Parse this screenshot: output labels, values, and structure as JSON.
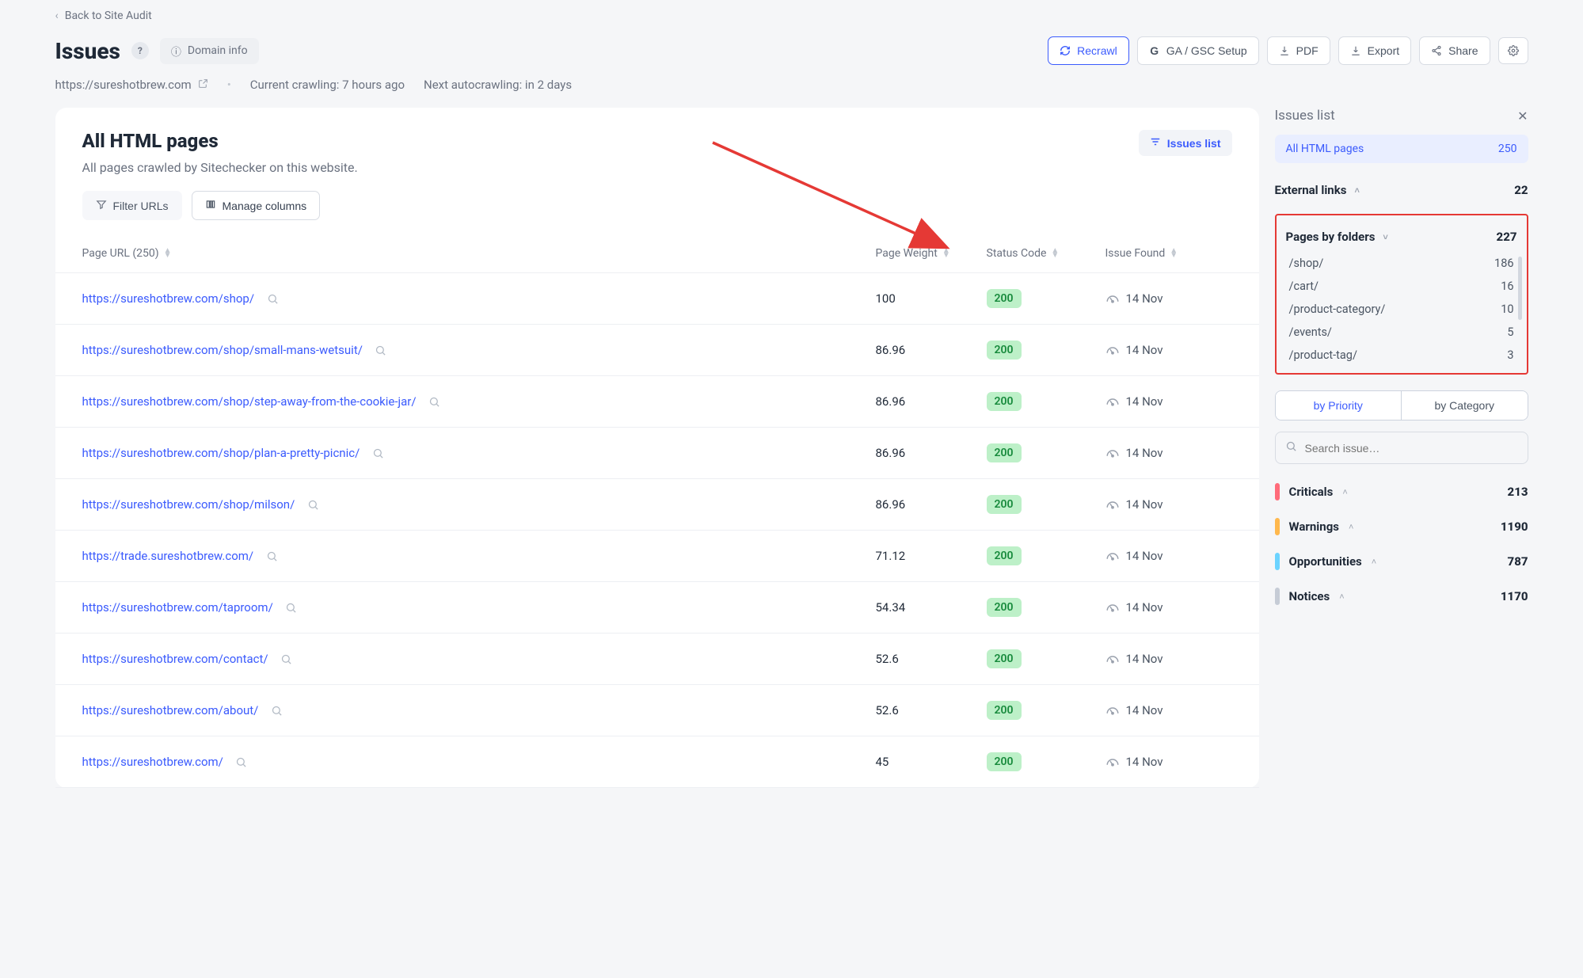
{
  "nav": {
    "back": "Back to Site Audit"
  },
  "page": {
    "title": "Issues",
    "domain_info": "Domain info",
    "site_url": "https://sureshotbrew.com",
    "current_crawl": "Current crawling: 7 hours ago",
    "next_crawl": "Next autocrawling: in 2 days"
  },
  "actions": {
    "recrawl": "Recrawl",
    "gsc": "GA / GSC Setup",
    "pdf": "PDF",
    "export": "Export",
    "share": "Share"
  },
  "main": {
    "heading": "All HTML pages",
    "subheading": "All pages crawled by Sitechecker on this website.",
    "issues_list_btn": "Issues list",
    "filter_urls": "Filter URLs",
    "manage_columns": "Manage columns",
    "columns": {
      "url": "Page URL (250)",
      "weight": "Page Weight",
      "status": "Status Code",
      "found": "Issue Found"
    }
  },
  "rows": [
    {
      "url": "https://sureshotbrew.com/shop/",
      "weight": "100",
      "status": "200",
      "found": "14 Nov"
    },
    {
      "url": "https://sureshotbrew.com/shop/small-mans-wetsuit/",
      "weight": "86.96",
      "status": "200",
      "found": "14 Nov"
    },
    {
      "url": "https://sureshotbrew.com/shop/step-away-from-the-cookie-jar/",
      "weight": "86.96",
      "status": "200",
      "found": "14 Nov"
    },
    {
      "url": "https://sureshotbrew.com/shop/plan-a-pretty-picnic/",
      "weight": "86.96",
      "status": "200",
      "found": "14 Nov"
    },
    {
      "url": "https://sureshotbrew.com/shop/milson/",
      "weight": "86.96",
      "status": "200",
      "found": "14 Nov"
    },
    {
      "url": "https://trade.sureshotbrew.com/",
      "weight": "71.12",
      "status": "200",
      "found": "14 Nov"
    },
    {
      "url": "https://sureshotbrew.com/taproom/",
      "weight": "54.34",
      "status": "200",
      "found": "14 Nov"
    },
    {
      "url": "https://sureshotbrew.com/contact/",
      "weight": "52.6",
      "status": "200",
      "found": "14 Nov"
    },
    {
      "url": "https://sureshotbrew.com/about/",
      "weight": "52.6",
      "status": "200",
      "found": "14 Nov"
    },
    {
      "url": "https://sureshotbrew.com/",
      "weight": "45",
      "status": "200",
      "found": "14 Nov"
    }
  ],
  "sidebar": {
    "title": "Issues list",
    "active": {
      "label": "All HTML pages",
      "count": "250"
    },
    "external": {
      "label": "External links",
      "count": "22"
    },
    "folders_section": {
      "label": "Pages by folders",
      "count": "227"
    },
    "folders": [
      {
        "path": "/shop/",
        "count": "186"
      },
      {
        "path": "/cart/",
        "count": "16"
      },
      {
        "path": "/product-category/",
        "count": "10"
      },
      {
        "path": "/events/",
        "count": "5"
      },
      {
        "path": "/product-tag/",
        "count": "3"
      }
    ],
    "seg": {
      "priority": "by Priority",
      "category": "by Category"
    },
    "search_placeholder": "Search issue…",
    "cats": [
      {
        "name": "Criticals",
        "count": "213",
        "color": "#ff6b7a"
      },
      {
        "name": "Warnings",
        "count": "1190",
        "color": "#ffb84d"
      },
      {
        "name": "Opportunities",
        "count": "787",
        "color": "#6bd3ff"
      },
      {
        "name": "Notices",
        "count": "1170",
        "color": "#c6ccd6"
      }
    ]
  }
}
